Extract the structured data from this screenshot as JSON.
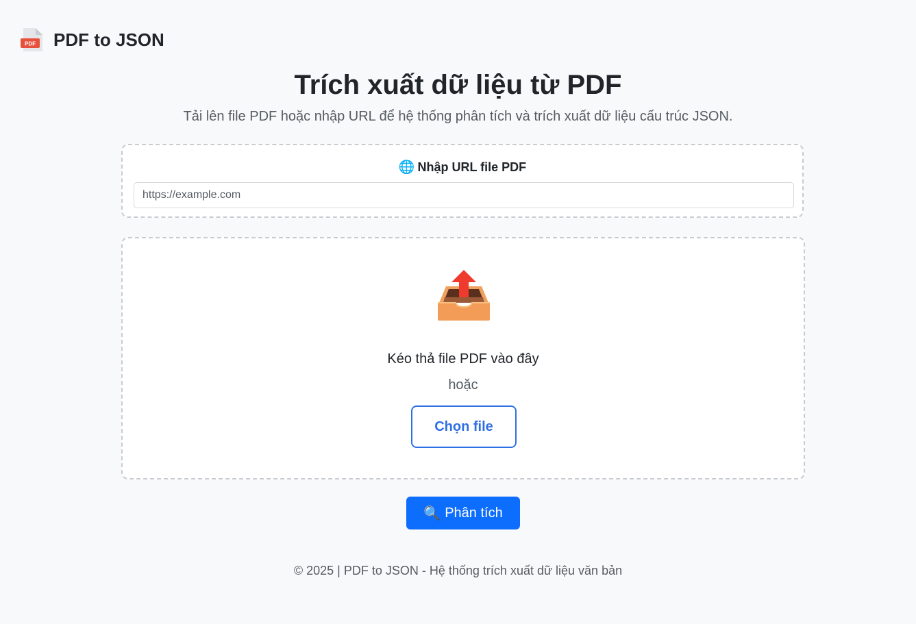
{
  "header": {
    "brand": "PDF to JSON",
    "logo_icon": "pdf-file-icon",
    "logo_badge": "PDF"
  },
  "main": {
    "title": "Trích xuất dữ liệu từ PDF",
    "subtitle": "Tải lên file PDF hoặc nhập URL để hệ thống phân tích và trích xuất dữ liệu cấu trúc JSON."
  },
  "url_section": {
    "icon": "🌐",
    "label": "Nhập URL file PDF",
    "placeholder": "https://example.com"
  },
  "drop_zone": {
    "icon": "inbox-upload-icon",
    "text": "Kéo thả file PDF vào đây",
    "or_text": "hoặc",
    "choose_label": "Chọn file"
  },
  "analyze": {
    "icon": "🔍",
    "label": "Phân tích"
  },
  "footer": {
    "text": "© 2025 | PDF to JSON - Hệ thống trích xuất dữ liệu văn bản"
  },
  "colors": {
    "accent": "#0d6efd",
    "outline_button": "#2f6fe4",
    "background": "#f8f9fa",
    "pdf_badge": "#e8503e"
  }
}
